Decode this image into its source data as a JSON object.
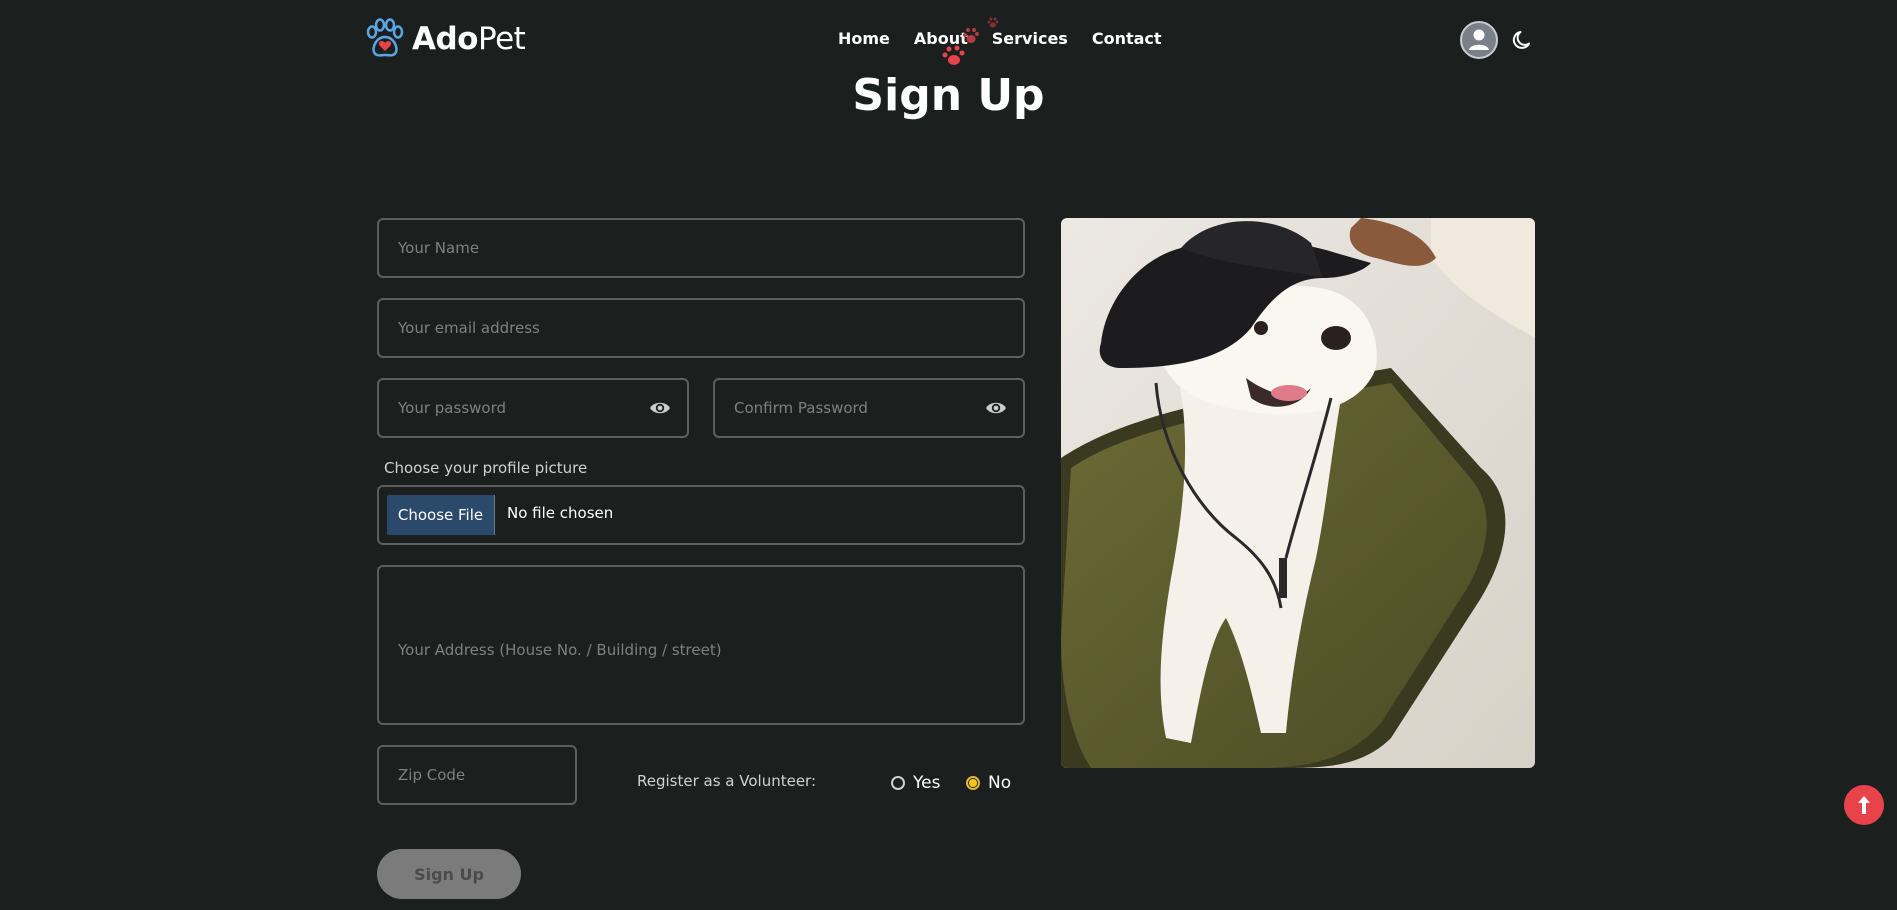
{
  "brand": {
    "name_bold": "Ado",
    "name_light": "Pet"
  },
  "nav": {
    "items": [
      "Home",
      "About",
      "Services",
      "Contact"
    ]
  },
  "page": {
    "title": "Sign Up"
  },
  "form": {
    "name_placeholder": "Your Name",
    "email_placeholder": "Your email address",
    "password_placeholder": "Your password",
    "confirm_placeholder": "Confirm Password",
    "picture_label": "Choose your profile picture",
    "choose_file_label": "Choose File",
    "file_status": "No file chosen",
    "address_placeholder": "Your Address (House No. / Building / street)",
    "zip_placeholder": "Zip Code",
    "volunteer_label": "Register as a Volunteer:",
    "volunteer_options": [
      "Yes",
      "No"
    ],
    "volunteer_selected": "No",
    "submit_label": "Sign Up"
  },
  "icons": {
    "logo": "paw-heart-icon",
    "account": "user-avatar-icon",
    "theme": "moon-icon",
    "password_toggle": "eye-icon",
    "scroll_top": "arrow-up-icon"
  },
  "colors": {
    "background": "#1b201f",
    "accent": "#e8434b",
    "logo_blue": "#5aa7e6",
    "radio_selected": "#f3c21c",
    "file_button": "#2b4a6b"
  }
}
